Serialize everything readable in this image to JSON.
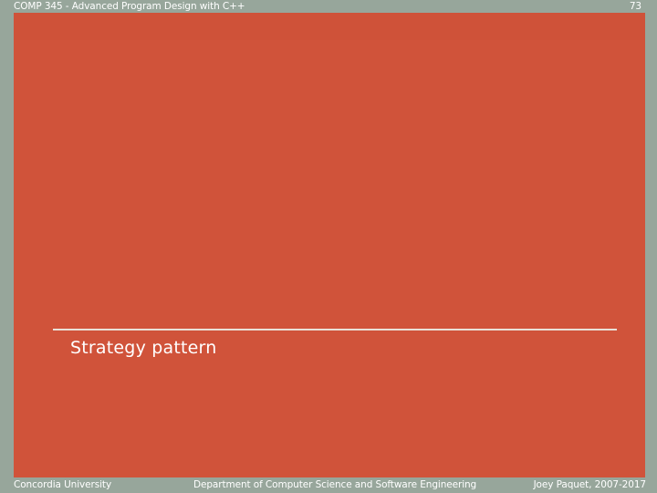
{
  "header": {
    "course_title": "COMP 345 - Advanced Program Design with C++",
    "slide_number": "73"
  },
  "slide": {
    "title": "Strategy pattern"
  },
  "footer": {
    "left": "Concordia University",
    "center": "Department of Computer Science and Software Engineering",
    "right": "Joey Paquet, 2007-2017"
  },
  "colors": {
    "background": "#97a69b",
    "panel": "#d0533a",
    "text": "#ffffff"
  }
}
